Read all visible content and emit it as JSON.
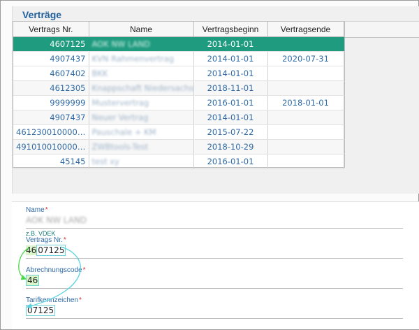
{
  "panel": {
    "title": "Verträge"
  },
  "table": {
    "columns": [
      "Vertrags Nr.",
      "Name",
      "Vertragsbeginn",
      "Vertragsende"
    ],
    "rows": [
      {
        "nr": "4607125",
        "name": "AOK NW LAND",
        "begin": "2014-01-01",
        "end": ""
      },
      {
        "nr": "4907437",
        "name": "KVN Rahmenvertrag",
        "begin": "2014-01-01",
        "end": "2020-07-31"
      },
      {
        "nr": "4607402",
        "name": "BKK",
        "begin": "2014-01-01",
        "end": ""
      },
      {
        "nr": "4612305",
        "name": "Knappschaft Niedersachsen",
        "begin": "2018-11-01",
        "end": ""
      },
      {
        "nr": "9999999",
        "name": "Mustervertrag",
        "begin": "2016-01-01",
        "end": "2018-01-01"
      },
      {
        "nr": "4907437",
        "name": "Neuer Vertrag",
        "begin": "2014-01-01",
        "end": ""
      },
      {
        "nr": "4612300100000...",
        "name": "Pauschale + KM",
        "begin": "2015-07-22",
        "end": ""
      },
      {
        "nr": "4910100100000...",
        "name": "ZWBtools-Test",
        "begin": "2018-10-29",
        "end": ""
      },
      {
        "nr": "45145",
        "name": "test xy",
        "begin": "2016-01-01",
        "end": ""
      }
    ]
  },
  "form": {
    "name_label": "Name",
    "name_value": "AOK NW LAND",
    "name_hint": "z.B. VDEK",
    "nr_label": "Vertrags Nr.",
    "nr_prefix": "46",
    "nr_rest": "07125",
    "abr_label": "Abrechnungscode",
    "abr_value": "46",
    "tarif_label": "Tarifkennzeichen",
    "tarif_value": "07125",
    "required_mark": "*"
  },
  "colors": {
    "accent": "#1f5f9c",
    "selected_row": "#1f9b7f",
    "arrow_green": "#4cd94c",
    "arrow_cyan": "#59d3df"
  }
}
